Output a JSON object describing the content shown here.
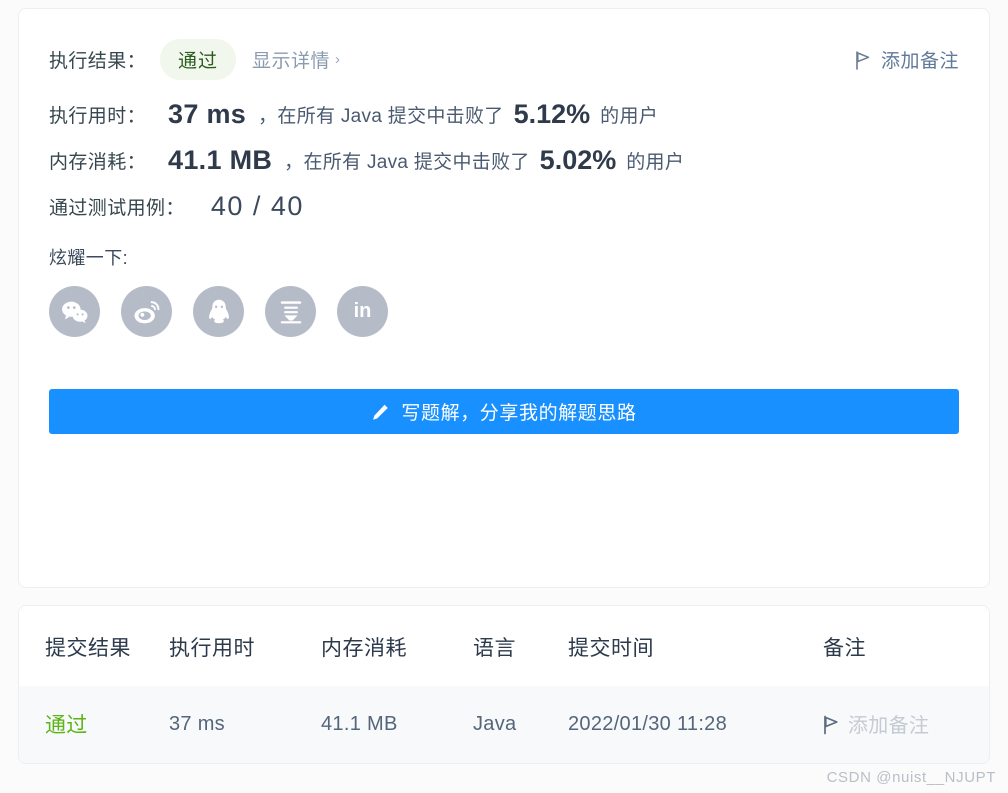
{
  "result_card": {
    "result_row": {
      "label": "执行结果：",
      "status": "通过",
      "status_bg": "#f2f7ed",
      "status_color": "#2d5c1f",
      "detail_link": "显示详情",
      "detail_chevron": "›",
      "add_note": "添加备注",
      "flag_icon": "flag-icon"
    },
    "runtime_row": {
      "label": "执行用时：",
      "value": "37 ms",
      "middle_text": "，在所有 Java 提交中击败了",
      "percent": "5.12%",
      "suffix": "的用户"
    },
    "memory_row": {
      "label": "内存消耗：",
      "value": "41.1 MB",
      "middle_text": "，在所有 Java 提交中击败了",
      "percent": "5.02%",
      "suffix": "的用户"
    },
    "cases_row": {
      "label": "通过测试用例：",
      "value": "40 / 40"
    },
    "share": {
      "label": "炫耀一下:",
      "icons": [
        {
          "name": "wechat-icon",
          "glyph": ""
        },
        {
          "name": "weibo-icon",
          "glyph": ""
        },
        {
          "name": "qq-icon",
          "glyph": ""
        },
        {
          "name": "douban-icon",
          "glyph": "豆"
        },
        {
          "name": "linkedin-icon",
          "glyph": "in"
        }
      ]
    },
    "cta": {
      "label": "写题解，分享我的解题思路",
      "icon": "pencil-icon",
      "color": "#1890ff"
    }
  },
  "submissions": {
    "headers": [
      "提交结果",
      "执行用时",
      "内存消耗",
      "语言",
      "提交时间",
      "备注"
    ],
    "rows": [
      {
        "status": "通过",
        "status_color": "#5cb415",
        "runtime": "37 ms",
        "memory": "41.1 MB",
        "language": "Java",
        "time": "2022/01/30 11:28",
        "note": "添加备注"
      }
    ]
  },
  "watermark": "CSDN @nuist__NJUPT"
}
